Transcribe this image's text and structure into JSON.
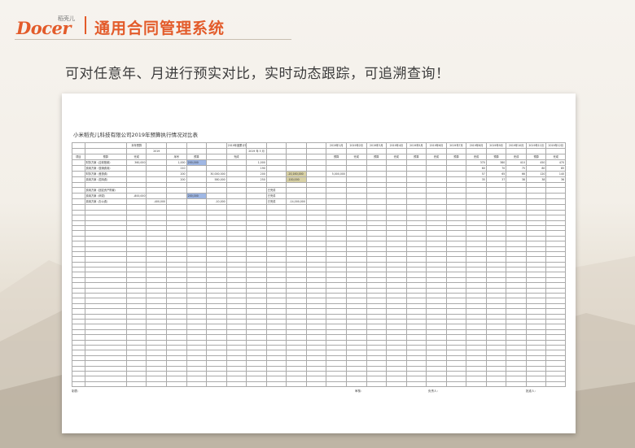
{
  "header": {
    "logo_text": "Docer",
    "logo_tag": "稻壳儿",
    "title": "通用合同管理系统",
    "subtitle": "可对任意年、月进行预实对比，实时动态跟踪，可追溯查询！"
  },
  "sheet": {
    "title": "小米稻壳儿科技有限公司2019年预算执行情况对比表",
    "header_row1": [
      "本年预算",
      "2019年度累计完成情况"
    ],
    "year_label": "2019",
    "cum_year": "2019 年 3 月",
    "month_headers": [
      "2019年1月",
      "2019年2月",
      "2019年3月",
      "2019年4月",
      "2019年5月",
      "2019年6月",
      "2019年7月",
      "2019年8月",
      "2019年9月",
      "2019年10月",
      "2019年11月",
      "2019年12月"
    ],
    "col_headers": [
      "项目",
      "预算",
      "完成",
      "序号",
      "预算",
      "完成",
      "预算",
      "完成"
    ],
    "rows": [
      [
        "财务方案（应收账款）",
        "360,000",
        "",
        "1,000",
        "",
        "",
        "",
        "1,000",
        "",
        "",
        "",
        "",
        "",
        "",
        "",
        "",
        "",
        "",
        "370",
        "380",
        "410",
        "450",
        "470",
        "490"
      ],
      [
        "费用方案（营销费用）",
        "",
        "",
        "210",
        "",
        "",
        "",
        "190",
        "",
        "",
        "",
        "",
        "",
        "",
        "",
        "",
        "",
        "",
        "60",
        "70",
        "75",
        "80",
        "85",
        "90"
      ],
      [
        "财务方案（差旅费）",
        "",
        "",
        "200",
        "",
        "30,000,000",
        "",
        "200",
        "",
        "30,000,000",
        "",
        "5,000,000",
        "",
        "",
        "",
        "",
        "",
        "",
        "57",
        "65",
        "66",
        "120",
        "140",
        "17"
      ],
      [
        "费用方案（招待费）",
        "",
        "",
        "200",
        "",
        "580,000",
        "",
        "250",
        "",
        "",
        "",
        "",
        "",
        "",
        "",
        "",
        "",
        "",
        "35",
        "37",
        "38",
        "38",
        "36",
        "38"
      ]
    ],
    "rows2": [
      [
        "费用方案（固定资产购置）",
        "",
        "",
        "",
        "",
        "",
        "",
        "",
        "已完成",
        "",
        "",
        "",
        "",
        "",
        ""
      ],
      [
        "费用方案（研发）",
        "-800,000",
        "",
        "",
        "",
        "",
        "",
        "",
        "已完成",
        "",
        "",
        "",
        "",
        "",
        ""
      ],
      [
        "费用方案（办公费）",
        "",
        "-400,000",
        "",
        "",
        "-10,000",
        "",
        "",
        "已完成",
        "-14,000,000",
        "",
        "",
        "",
        "",
        ""
      ]
    ],
    "blue_value": "200,000",
    "olive_value_1": "-20,160,000",
    "olive_value_2": "-100,000",
    "footer": {
      "prepared": "制表：",
      "reviewer": "审核：",
      "leader": "负责人：",
      "approver": "批准人："
    }
  },
  "colors": {
    "brand": "#e35b2a",
    "highlight_blue": "#9fb7e4",
    "highlight_olive": "#d9d2a6"
  }
}
